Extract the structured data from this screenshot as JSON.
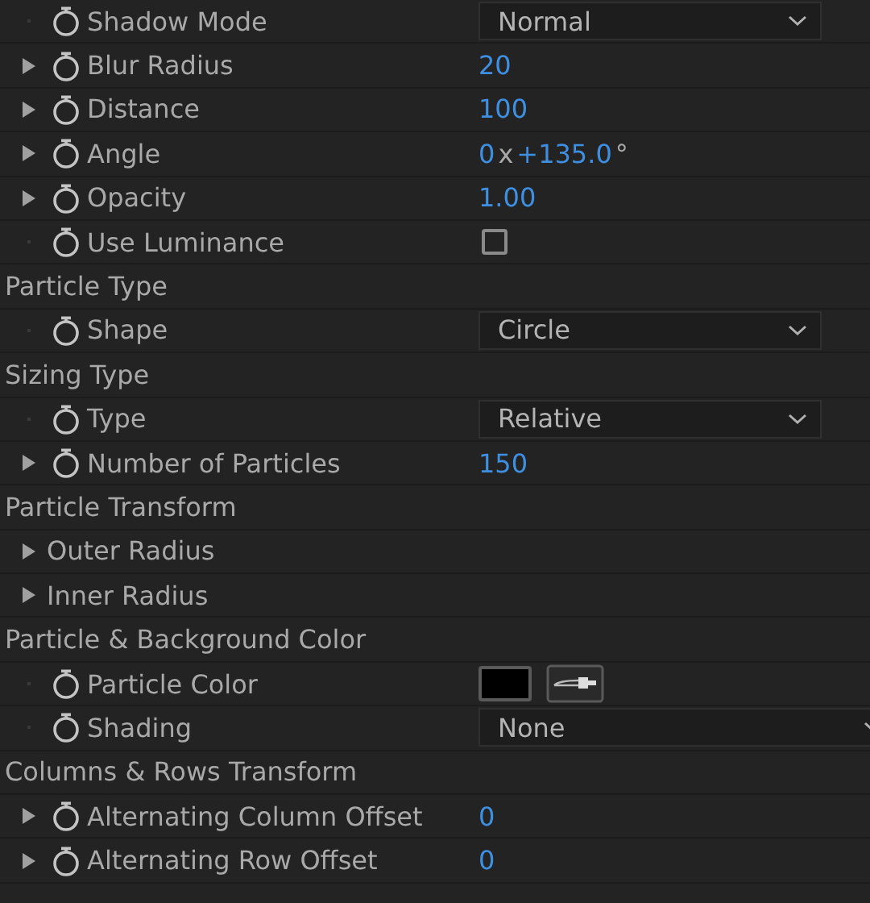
{
  "rows": [
    {
      "kind": "dropdown",
      "label": "Shadow Mode",
      "twirl": false,
      "value": "Normal"
    },
    {
      "kind": "number",
      "label": "Blur Radius",
      "twirl": true,
      "value": "20"
    },
    {
      "kind": "number",
      "label": "Distance",
      "twirl": true,
      "value": "100"
    },
    {
      "kind": "angle",
      "label": "Angle",
      "twirl": true,
      "revolutions": "0",
      "rev_unit": "x",
      "degrees": "+135.0",
      "deg_unit": "°"
    },
    {
      "kind": "number",
      "label": "Opacity",
      "twirl": true,
      "value": "1.00"
    },
    {
      "kind": "checkbox",
      "label": "Use Luminance",
      "twirl": false,
      "checked": false
    },
    {
      "kind": "header",
      "label": "Particle Type"
    },
    {
      "kind": "dropdown",
      "label": "Shape",
      "twirl": false,
      "value": "Circle"
    },
    {
      "kind": "header",
      "label": "Sizing Type"
    },
    {
      "kind": "dropdown",
      "label": "Type",
      "twirl": false,
      "value": "Relative"
    },
    {
      "kind": "number",
      "label": "Number of Particles",
      "twirl": true,
      "value": "150"
    },
    {
      "kind": "header",
      "label": "Particle Transform"
    },
    {
      "kind": "group",
      "label": "Outer Radius"
    },
    {
      "kind": "group",
      "label": "Inner Radius"
    },
    {
      "kind": "header",
      "label": "Particle & Background Color"
    },
    {
      "kind": "color",
      "label": "Particle Color",
      "twirl": false,
      "color": "#000000"
    },
    {
      "kind": "dropdown",
      "label": "Shading",
      "twirl": false,
      "value": "None",
      "wide": true
    },
    {
      "kind": "header",
      "label": "Columns & Rows Transform"
    },
    {
      "kind": "number",
      "label": "Alternating Column Offset",
      "twirl": true,
      "value": "0"
    },
    {
      "kind": "number",
      "label": "Alternating Row Offset",
      "twirl": true,
      "value": "0"
    }
  ]
}
